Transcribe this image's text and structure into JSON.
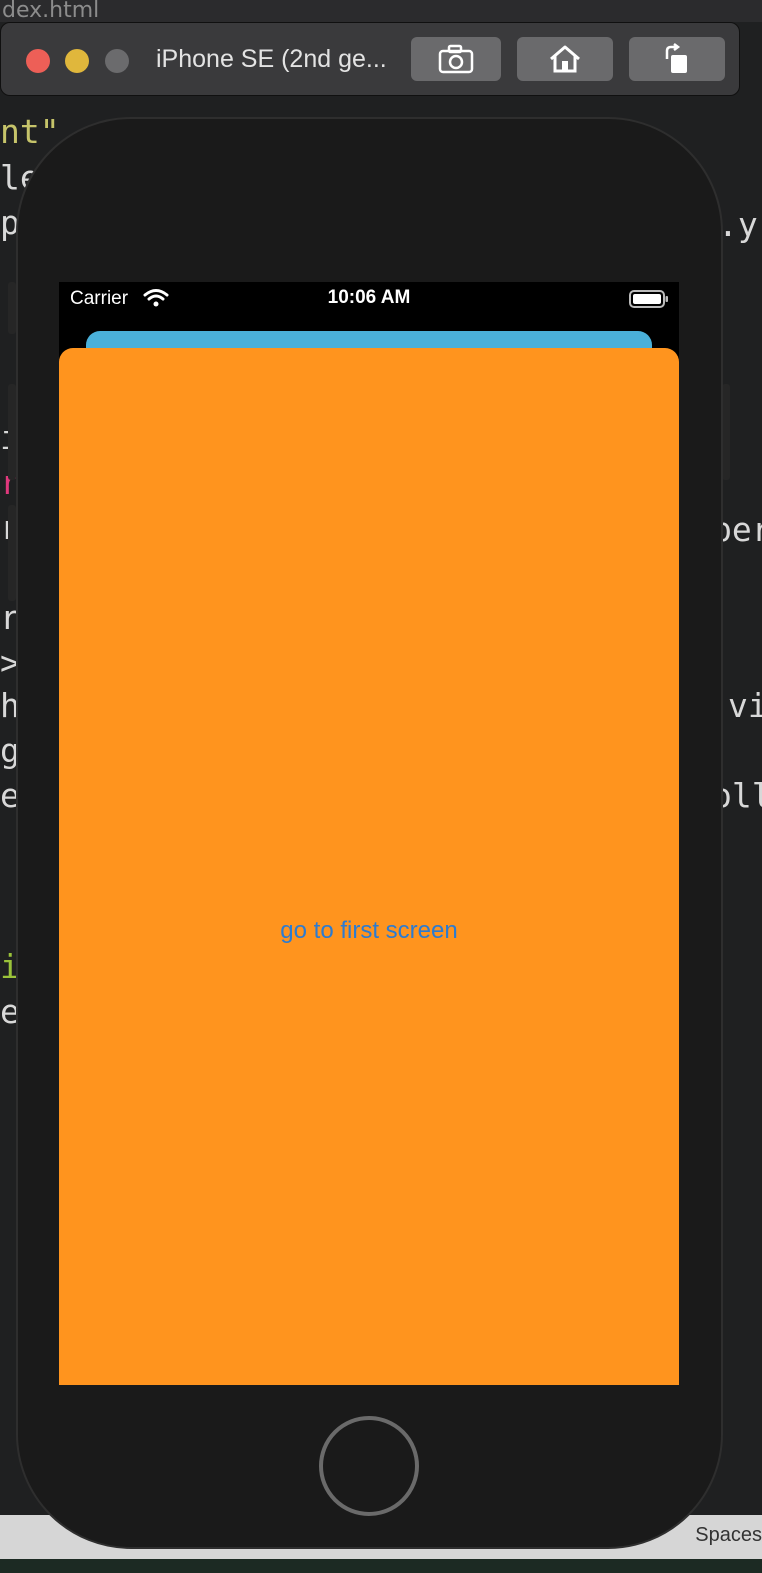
{
  "editor": {
    "tab_text": "dex.html",
    "code_fragments_left": [
      "nt\"",
      "le",
      "p",
      "i",
      "r",
      "r",
      "r",
      ">",
      "h",
      "g",
      "e",
      "i",
      "e"
    ],
    "code_fragments_right": [
      ".y",
      "per",
      "vi",
      "oll"
    ],
    "status_text": "Spaces"
  },
  "simulator": {
    "title": "iPhone SE (2nd ge...",
    "buttons": [
      {
        "name": "screenshot-button",
        "icon": "camera-icon"
      },
      {
        "name": "home-button",
        "icon": "home-icon"
      },
      {
        "name": "rotate-button",
        "icon": "rotate-icon"
      }
    ]
  },
  "status_bar": {
    "carrier": "Carrier",
    "time": "10:06 AM"
  },
  "screen": {
    "link_text": "go to first screen"
  },
  "colors": {
    "back_card": "#4ab0d9",
    "front_card": "#ff941e",
    "link": "#2c7bd1"
  }
}
